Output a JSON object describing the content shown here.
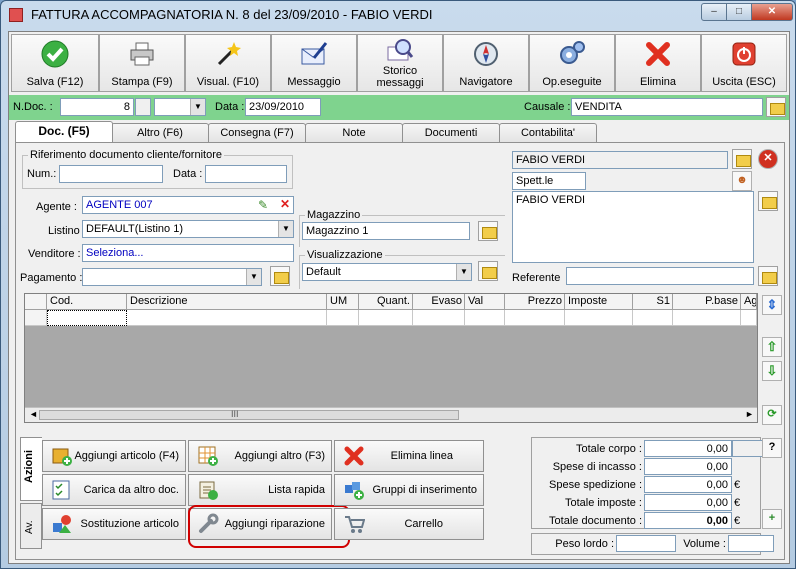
{
  "window": {
    "title": "FATTURA ACCOMPAGNATORIA N. 8  del 23/09/2010 - FABIO VERDI",
    "minimize": "–",
    "maximize": "□",
    "close": "✕"
  },
  "toolbar": [
    {
      "label": "Salva (F12)",
      "icon": "check-icon"
    },
    {
      "label": "Stampa (F9)",
      "icon": "printer-icon"
    },
    {
      "label": "Visual. (F10)",
      "icon": "magic-wand-icon"
    },
    {
      "label": "Messaggio",
      "icon": "envelope-pen-icon"
    },
    {
      "label1": "Storico",
      "label2": "messaggi",
      "icon": "magnifier-envelope-icon"
    },
    {
      "label": "Navigatore",
      "icon": "compass-icon"
    },
    {
      "label": "Op.eseguite",
      "icon": "gears-icon"
    },
    {
      "label": "Elimina",
      "icon": "red-x-icon"
    },
    {
      "label": "Uscita (ESC)",
      "icon": "power-icon"
    }
  ],
  "docbar": {
    "ndoc_label": "N.Doc. :",
    "ndoc_value": "8",
    "data_label": "Data :",
    "data_value": "23/09/2010",
    "causale_label": "Causale :",
    "causale_value": "VENDITA"
  },
  "tabs": [
    "Doc. (F5)",
    "Altro (F6)",
    "Consegna (F7)",
    "Note",
    "Documenti",
    "Contabilita'"
  ],
  "riferimento": {
    "title": "Riferimento documento cliente/fornitore",
    "num_label": "Num.:",
    "data_label": "Data :",
    "num_value": "",
    "data_value": ""
  },
  "fields": {
    "agente_label": "Agente :",
    "agente_value": "AGENTE 007",
    "listino_label": "Listino :",
    "listino_value": "DEFAULT(Listino 1)",
    "venditore_label": "Venditore :",
    "venditore_value": "Seleziona...",
    "pagamento_label": "Pagamento :",
    "pagamento_value": ""
  },
  "magazzino": {
    "title": "Magazzino",
    "value": "Magazzino 1"
  },
  "visualizzazione": {
    "title": "Visualizzazione",
    "value": "Default"
  },
  "cliente": {
    "name": "FABIO VERDI",
    "spett": "Spett.le",
    "address": "FABIO VERDI",
    "referente_label": "Referente",
    "referente_value": ""
  },
  "grid": {
    "columns": [
      "Cod.",
      "Descrizione",
      "UM",
      "Quant.",
      "Evaso",
      "Val",
      "Prezzo",
      "Imposte",
      "S1",
      "P.base",
      "Ag"
    ],
    "scroll_marker": "III"
  },
  "side_tabs": [
    "Azioni",
    "Av."
  ],
  "actions": [
    [
      "Aggiungi articolo (F4)",
      "Aggiungi altro (F3)",
      "Elimina linea"
    ],
    [
      "Carica da altro doc.",
      "Lista rapida",
      "Gruppi di inserimento"
    ],
    [
      "Sostituzione articolo",
      "Aggiungi riparazione",
      "Carrello"
    ]
  ],
  "totals": {
    "corpo_label": "Totale corpo :",
    "corpo_value": "0,00",
    "help": "?",
    "incasso_label": "Spese di incasso :",
    "incasso_value": "0,00",
    "spedizione_label": "Spese spedizione :",
    "spedizione_value": "0,00",
    "imposte_label": "Totale imposte :",
    "imposte_value": "0,00",
    "documento_label": "Totale documento :",
    "documento_value": "0,00",
    "currency": "€"
  },
  "weights": {
    "peso_label": "Peso lordo :",
    "peso_value": "",
    "volume_label": "Volume :",
    "volume_value": ""
  },
  "colors": {
    "docbar": "#7fd38e",
    "highlight": "#d00000",
    "agente_text": "#0000c0"
  }
}
